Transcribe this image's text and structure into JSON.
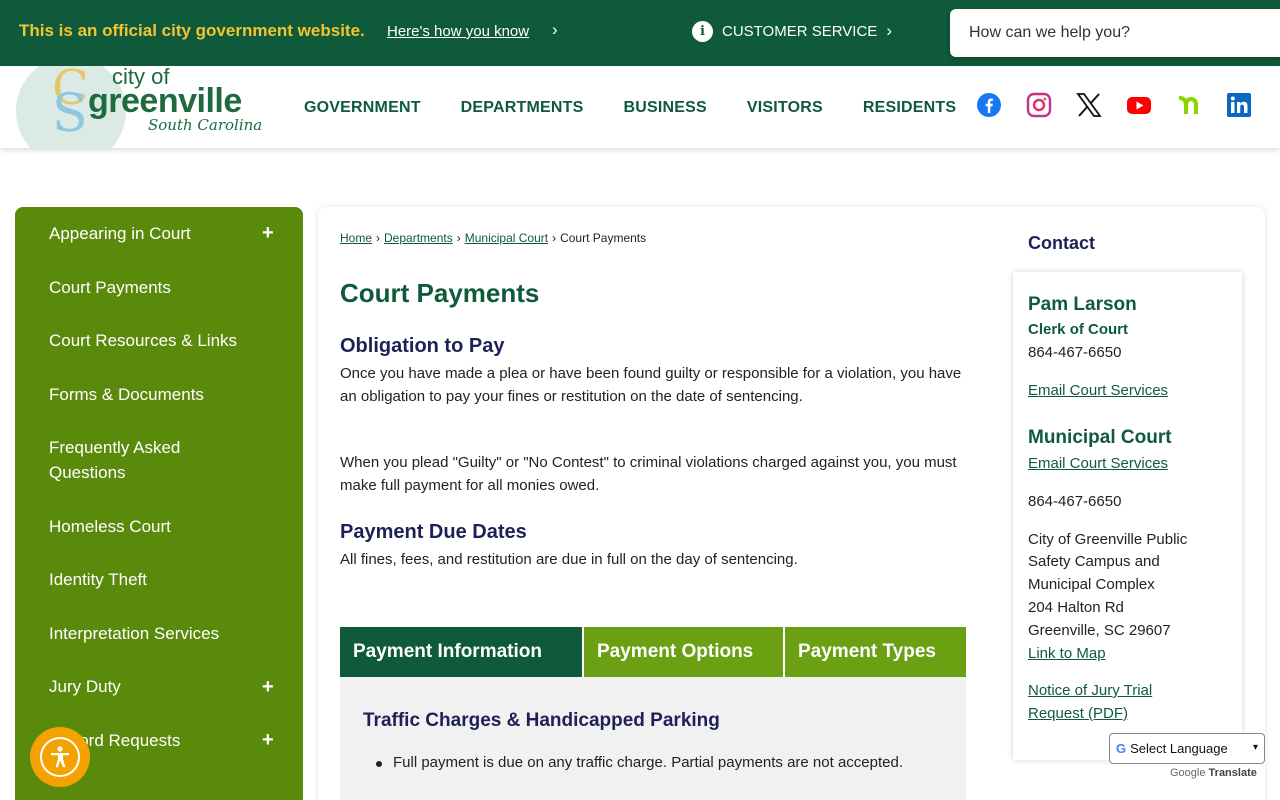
{
  "banner": {
    "official_text": "This is an official city government website.",
    "how_know_link": "Here's how you know",
    "chevron": "›",
    "customer_service_label": "CUSTOMER SERVICE",
    "info_glyph": "i"
  },
  "search": {
    "placeholder": "How can we help you?"
  },
  "logo": {
    "city_text": "city of",
    "name_text": "greenville",
    "state_text": "South Carolina",
    "c_glyph": "C",
    "s_glyph": "S"
  },
  "main_nav": {
    "items": [
      "GOVERNMENT",
      "DEPARTMENTS",
      "BUSINESS",
      "VISITORS",
      "RESIDENTS"
    ]
  },
  "social": {
    "icons": [
      "facebook-icon",
      "instagram-icon",
      "x-icon",
      "youtube-icon",
      "nextdoor-icon",
      "linkedin-icon"
    ]
  },
  "sidebar": {
    "items": [
      {
        "label": "Appearing in Court",
        "expandable": true
      },
      {
        "label": "Court Payments",
        "expandable": false
      },
      {
        "label": "Court Resources & Links",
        "expandable": false
      },
      {
        "label": "Forms & Documents",
        "expandable": false
      },
      {
        "label": "Frequently Asked Questions",
        "expandable": false
      },
      {
        "label": "Homeless Court",
        "expandable": false
      },
      {
        "label": "Identity Theft",
        "expandable": false
      },
      {
        "label": "Interpretation Services",
        "expandable": false
      },
      {
        "label": "Jury Duty",
        "expandable": true
      },
      {
        "label": "Record Requests",
        "expandable": true
      }
    ],
    "plus_glyph": "+"
  },
  "breadcrumb": {
    "home": "Home",
    "departments": " Departments",
    "municipal_court": " Municipal Court",
    "current": "Court Payments",
    "separator": "›"
  },
  "page": {
    "title": "Court Payments",
    "section1_heading": "Obligation to Pay",
    "section1_p1": "Once you have made a plea or have been found guilty or responsible for a violation, you have an obligation to pay your fines or restitution on the date of sentencing.",
    "section1_p2": "When you plead \"Guilty\" or \"No Contest\" to criminal violations charged against you, you must make full payment for all monies owed.",
    "section2_heading": "Payment Due Dates",
    "section2_p1": "All fines, fees, and restitution are due in full on the day of sentencing."
  },
  "tabs": {
    "items": [
      "Payment Information",
      "Payment Options",
      "Payment Types"
    ],
    "active_index": 0,
    "panel_heading": "Traffic Charges & Handicapped Parking",
    "panel_bullet_1": "Full payment is due on any traffic charge. Partial payments are not accepted."
  },
  "contact": {
    "heading": "Contact",
    "person_name": "Pam Larson",
    "person_role": "Clerk of Court",
    "person_phone": "864-467-6650",
    "person_email": "Email Court Services",
    "dept_name": "Municipal Court",
    "dept_email": "Email Court Services",
    "dept_phone": "864-467-6650",
    "address_line1": "City of Greenville Public",
    "address_line2": "Safety Campus and",
    "address_line3": "Municipal Complex",
    "address_line4": "204 Halton Rd",
    "address_line5": "Greenville, SC 29607",
    "map_link": "Link to Map",
    "notice_link_1": "Notice of Jury Trial",
    "notice_link_2": "Request (PDF)"
  },
  "translate": {
    "select_label": "Select Language",
    "g_glyph": "G",
    "caret": "▾",
    "powered_google": "Google",
    "powered_translate": "Translate"
  },
  "colors": {
    "banner_green": "#0f5a3a",
    "sidebar_green": "#5a8a0c",
    "tab_inactive": "#6aa012",
    "heading_navy": "#1e2156",
    "official_yellow": "#f4c430",
    "access_orange": "#f4a200"
  }
}
